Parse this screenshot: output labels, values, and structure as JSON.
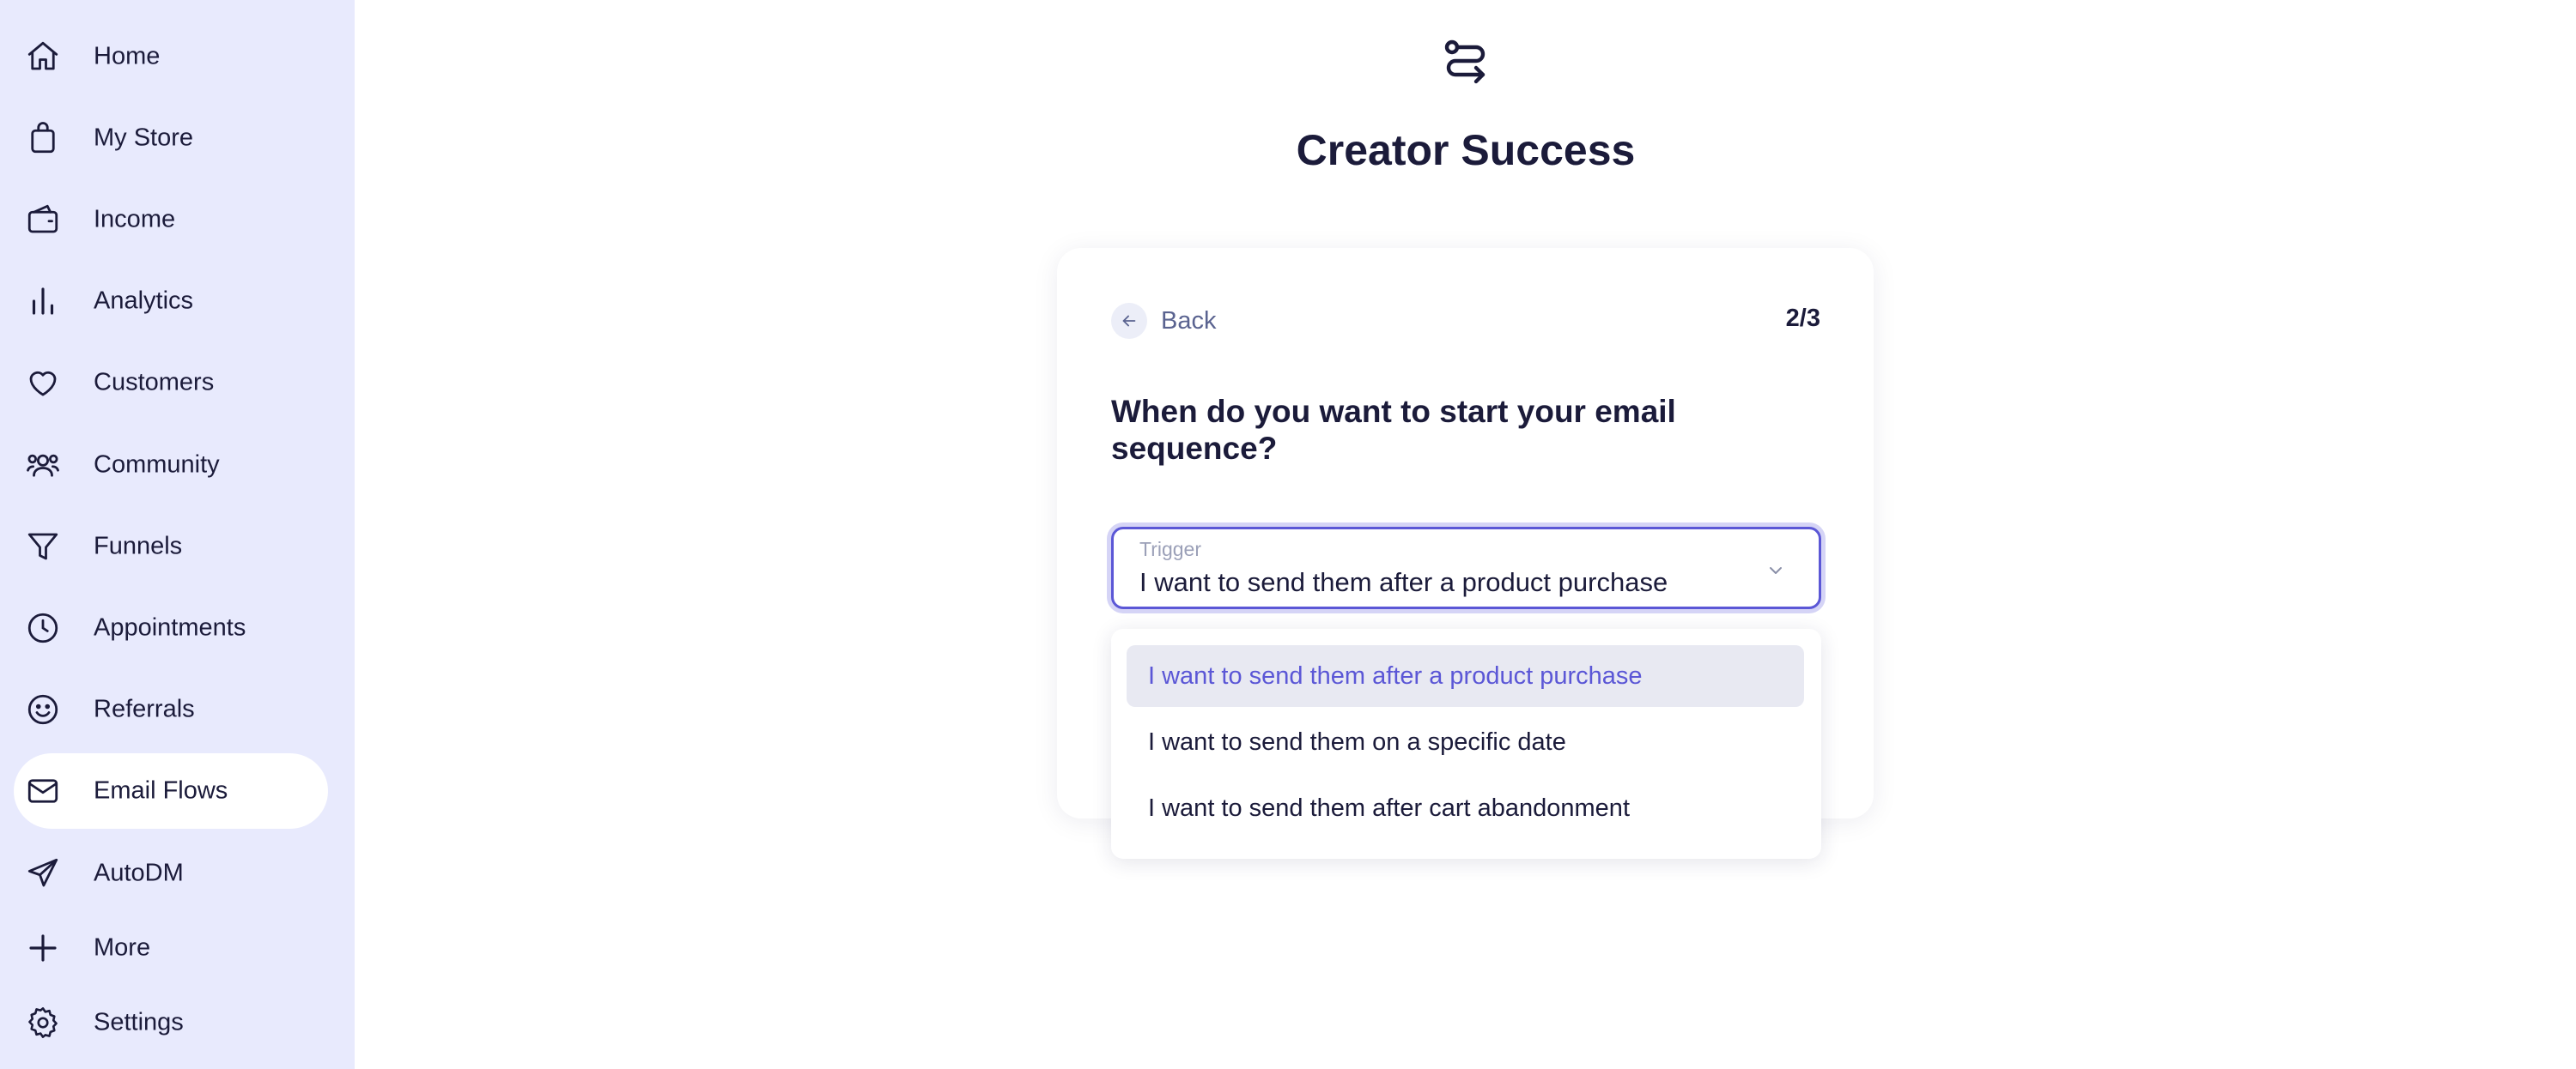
{
  "sidebar": {
    "items": [
      {
        "label": "Home",
        "icon": "home-icon"
      },
      {
        "label": "My Store",
        "icon": "shopping-bag-icon"
      },
      {
        "label": "Income",
        "icon": "wallet-icon"
      },
      {
        "label": "Analytics",
        "icon": "bar-chart-icon"
      },
      {
        "label": "Customers",
        "icon": "heart-icon"
      },
      {
        "label": "Community",
        "icon": "users-icon"
      },
      {
        "label": "Funnels",
        "icon": "filter-icon"
      },
      {
        "label": "Appointments",
        "icon": "clock-icon"
      },
      {
        "label": "Referrals",
        "icon": "smile-icon"
      },
      {
        "label": "Email Flows",
        "icon": "mail-icon",
        "active": true
      },
      {
        "label": "AutoDM",
        "icon": "send-icon"
      },
      {
        "label": "More",
        "icon": "plus-icon"
      },
      {
        "label": "Settings",
        "icon": "gear-icon"
      }
    ]
  },
  "main": {
    "logo_icon": "route-icon",
    "title": "Creator Success"
  },
  "card": {
    "back_label": "Back",
    "step": "2/3",
    "question": "When do you want to start your email sequence?",
    "trigger": {
      "caption": "Trigger",
      "value": "I want to send them after a product purchase"
    },
    "options": [
      {
        "label": "I want to send them after a product purchase",
        "selected": true
      },
      {
        "label": "I want to send them on a specific date",
        "selected": false
      },
      {
        "label": "I want to send them after cart abandonment",
        "selected": false
      }
    ]
  },
  "colors": {
    "sidebar_bg": "#e8eafd",
    "accent": "#5b57d6",
    "text": "#1b1b3a"
  }
}
